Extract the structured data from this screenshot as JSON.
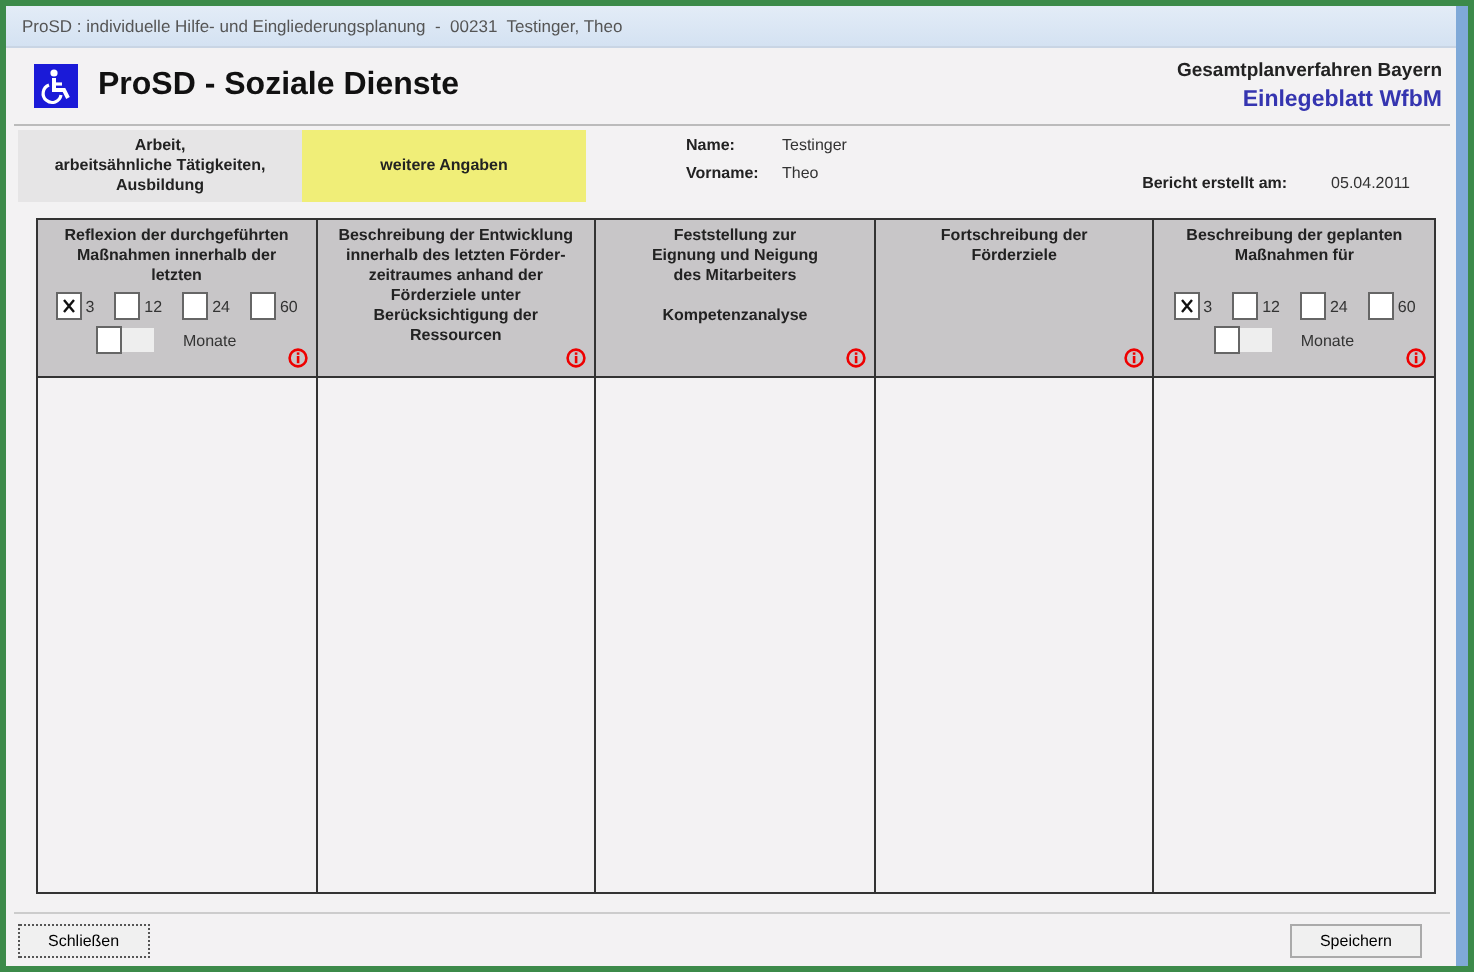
{
  "window": {
    "title": "ProSD : individuelle Hilfe- und Eingliederungsplanung  -  00231  Testinger, Theo"
  },
  "header": {
    "app_title": "ProSD - Soziale Dienste",
    "org": "Gesamtplanverfahren Bayern",
    "form_title": "Einlegeblatt WfbM"
  },
  "tabs": [
    {
      "label": "Arbeit,\narbeitsähnliche Tätigkeiten,\nAusbildung",
      "selected": false
    },
    {
      "label": "weitere Angaben",
      "selected": true
    }
  ],
  "person": [
    {
      "label": "Name:",
      "value": "Testinger"
    },
    {
      "label": "Vorname:",
      "value": "Theo"
    }
  ],
  "report": {
    "label": "Bericht erstellt am:",
    "value": "05.04.2011"
  },
  "columns": [
    {
      "kind": "period",
      "heading": "Reflexion der durchgeführten\nMaßnahmen innerhalb der\nletzten",
      "periods": [
        {
          "label": "3",
          "checked": true
        },
        {
          "label": "12",
          "checked": false
        },
        {
          "label": "24",
          "checked": false
        },
        {
          "label": "60",
          "checked": false
        }
      ],
      "custom": {
        "checked": false,
        "unit": "Monate"
      }
    },
    {
      "kind": "text",
      "heading": "Beschreibung der Entwicklung\ninnerhalb des letzten Förder-\nzeitraumes anhand der\nFörderziele unter\nBerücksichtigung der\nRessourcen"
    },
    {
      "kind": "text",
      "heading": "Feststellung zur\nEignung und Neigung\ndes Mitarbeiters\n\nKompetenzanalyse"
    },
    {
      "kind": "text",
      "heading": "Fortschreibung der\nFörderziele"
    },
    {
      "kind": "period",
      "heading": "Beschreibung der geplanten\nMaßnahmen für",
      "periods": [
        {
          "label": "3",
          "checked": true
        },
        {
          "label": "12",
          "checked": false
        },
        {
          "label": "24",
          "checked": false
        },
        {
          "label": "60",
          "checked": false
        }
      ],
      "custom": {
        "checked": false,
        "unit": "Monate"
      }
    }
  ],
  "buttons": {
    "close": "Schließen",
    "save": "Speichern"
  }
}
